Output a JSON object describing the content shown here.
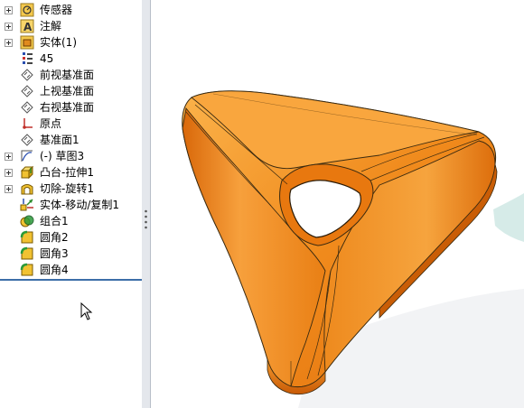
{
  "feature_tree": {
    "items": [
      {
        "label": "传感器",
        "icon": "sensor-icon",
        "expandable": true
      },
      {
        "label": "注解",
        "icon": "annotation-icon",
        "expandable": true
      },
      {
        "label": "实体(1)",
        "icon": "solid-bodies-icon",
        "expandable": true
      },
      {
        "label": "45",
        "icon": "material-icon",
        "expandable": false
      },
      {
        "label": "前视基准面",
        "icon": "plane-icon",
        "expandable": false
      },
      {
        "label": "上视基准面",
        "icon": "plane-icon",
        "expandable": false
      },
      {
        "label": "右视基准面",
        "icon": "plane-icon",
        "expandable": false
      },
      {
        "label": "原点",
        "icon": "origin-icon",
        "expandable": false
      },
      {
        "label": "基准面1",
        "icon": "plane-icon",
        "expandable": false
      },
      {
        "label": "(-) 草图3",
        "icon": "sketch-icon",
        "expandable": true
      },
      {
        "label": "凸台-拉伸1",
        "icon": "boss-extrude-icon",
        "expandable": true
      },
      {
        "label": "切除-旋转1",
        "icon": "cut-revolve-icon",
        "expandable": true
      },
      {
        "label": "实体-移动/复制1",
        "icon": "move-copy-body-icon",
        "expandable": false
      },
      {
        "label": "组合1",
        "icon": "combine-icon",
        "expandable": false
      },
      {
        "label": "圆角2",
        "icon": "fillet-icon",
        "expandable": false
      },
      {
        "label": "圆角3",
        "icon": "fillet-icon",
        "expandable": false
      },
      {
        "label": "圆角4",
        "icon": "fillet-icon",
        "expandable": false
      }
    ]
  },
  "colors": {
    "model_main": "#ef7f12",
    "model_light": "#fbb24a",
    "model_dark": "#c45a05",
    "rollback_bar": "#3c6ea8",
    "panel_border": "#9aa3ad"
  }
}
